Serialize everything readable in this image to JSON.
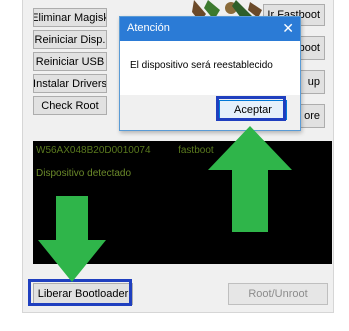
{
  "left_buttons": [
    {
      "label": "Eliminar Magisk"
    },
    {
      "label": "Reiniciar Disp."
    },
    {
      "label": "Reiniciar USB"
    },
    {
      "label": "Instalar Drivers"
    },
    {
      "label": "Check Root"
    }
  ],
  "right_buttons": [
    {
      "label": "Ir Fastboot"
    },
    {
      "label": "otboot"
    },
    {
      "label": "up"
    },
    {
      "label": "ore"
    }
  ],
  "console": {
    "serial": "W56AX048B20D0010074",
    "mode": "fastboot",
    "status": "Dispositivo detectado"
  },
  "dialog": {
    "title": "Atención",
    "close_glyph": "✕",
    "message": "El dispositivo será reestablecido",
    "accept_label": "Aceptar"
  },
  "bottom": {
    "unlock_label": "Liberar Bootloader",
    "root_label": "Root/Unroot"
  },
  "colors": {
    "highlight": "#1f3fbf",
    "arrow": "#2fb54a",
    "titlebar": "#2b7bd6"
  },
  "icons": {
    "arrows": "green-arrow-icon",
    "close": "close-icon"
  }
}
